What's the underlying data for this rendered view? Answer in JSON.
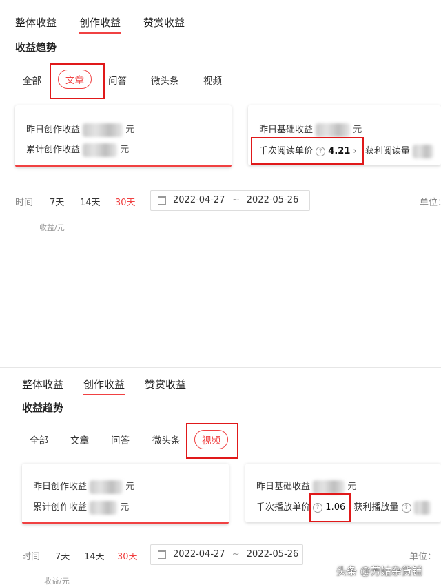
{
  "panel1": {
    "tabs": [
      "整体收益",
      "创作收益",
      "赞赏收益"
    ],
    "heading": "收益趋势",
    "subtabs": [
      "全部",
      "文章",
      "问答",
      "微头条",
      "视频"
    ],
    "card_left": {
      "line1": "昨日创作收益",
      "line2": "累计创作收益",
      "unit": "元"
    },
    "card_right": {
      "line1": "昨日基础收益",
      "unit": "元",
      "metric_label": "千次阅读单价",
      "metric_value": "4.21",
      "extra_label": "获利阅读量"
    },
    "time": {
      "label": "时间",
      "ranges": [
        "7天",
        "14天",
        "30天"
      ],
      "date_start": "2022-04-27",
      "sep": "~",
      "date_end": "2022-05-26",
      "unit_label": "单位："
    },
    "y_label": "收益/元"
  },
  "panel2": {
    "tabs": [
      "整体收益",
      "创作收益",
      "赞赏收益"
    ],
    "heading": "收益趋势",
    "subtabs": [
      "全部",
      "文章",
      "问答",
      "微头条",
      "视频"
    ],
    "card_left": {
      "line1": "昨日创作收益",
      "line2": "累计创作收益",
      "unit": "元"
    },
    "card_right": {
      "line1": "昨日基础收益",
      "unit": "元",
      "metric_label": "千次播放单价",
      "metric_value": "1.06",
      "extra_label": "获利播放量"
    },
    "time": {
      "label": "时间",
      "ranges": [
        "7天",
        "14天",
        "30天"
      ],
      "date_start": "2022-04-27",
      "sep": "~",
      "date_end": "2022-05-26",
      "unit_label": "单位："
    },
    "y_label": "收益/元"
  },
  "watermark": "头条 @芳姑杂货铺"
}
